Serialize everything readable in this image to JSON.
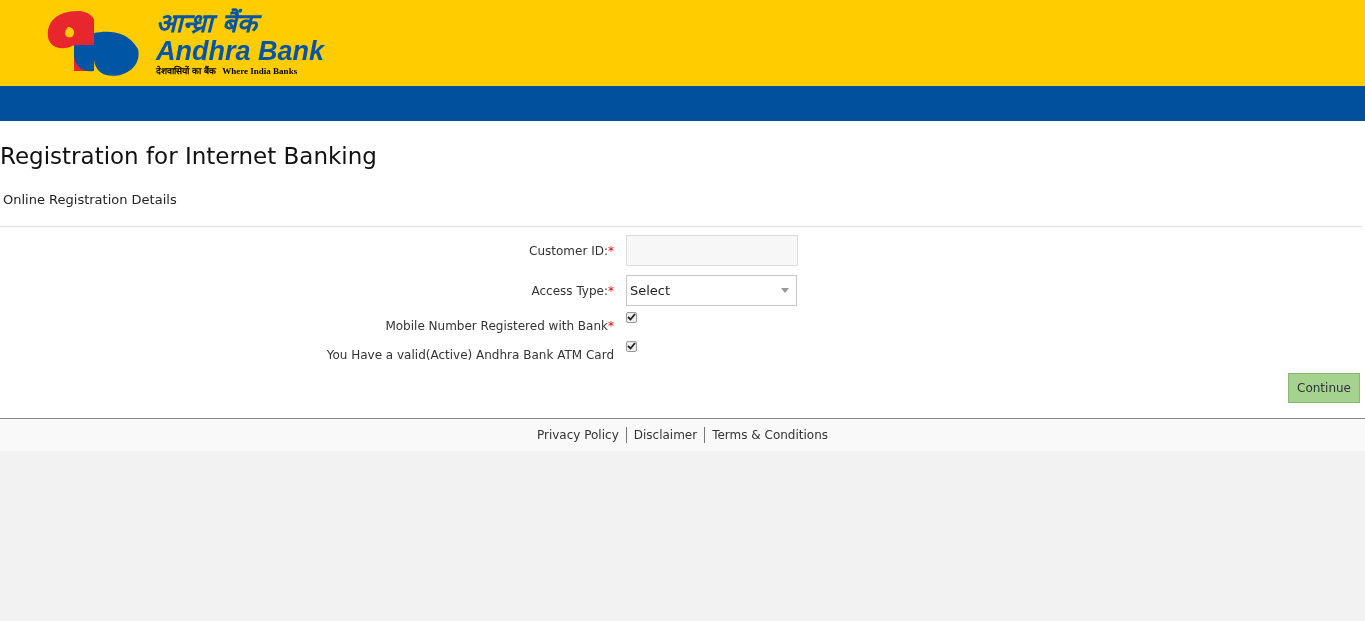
{
  "header": {
    "logo_hindi": "आन्ध्रा बैंक",
    "logo_name": "Andhra Bank",
    "logo_tagline_hindi": "देशवासियों का बैंक",
    "logo_tagline": "Where India Banks"
  },
  "page_title": "Registration for Internet Banking",
  "section_title": "Online Registration Details",
  "fields": [
    {
      "kind": "text",
      "label": "Customer ID:",
      "required_mark": "*"
    },
    {
      "kind": "select",
      "label": "Access Type:",
      "required_mark": "*",
      "value": "Select"
    },
    {
      "kind": "checkbox",
      "label": "Mobile Number Registered with Bank",
      "required_mark": "*",
      "checked": true
    },
    {
      "kind": "checkbox",
      "label": "You Have a valid(Active) Andhra Bank ATM Card",
      "checked": true
    }
  ],
  "continue_button": "Continue",
  "footer_links": [
    "Privacy Policy",
    "Disclaimer",
    "Terms & Conditions"
  ]
}
